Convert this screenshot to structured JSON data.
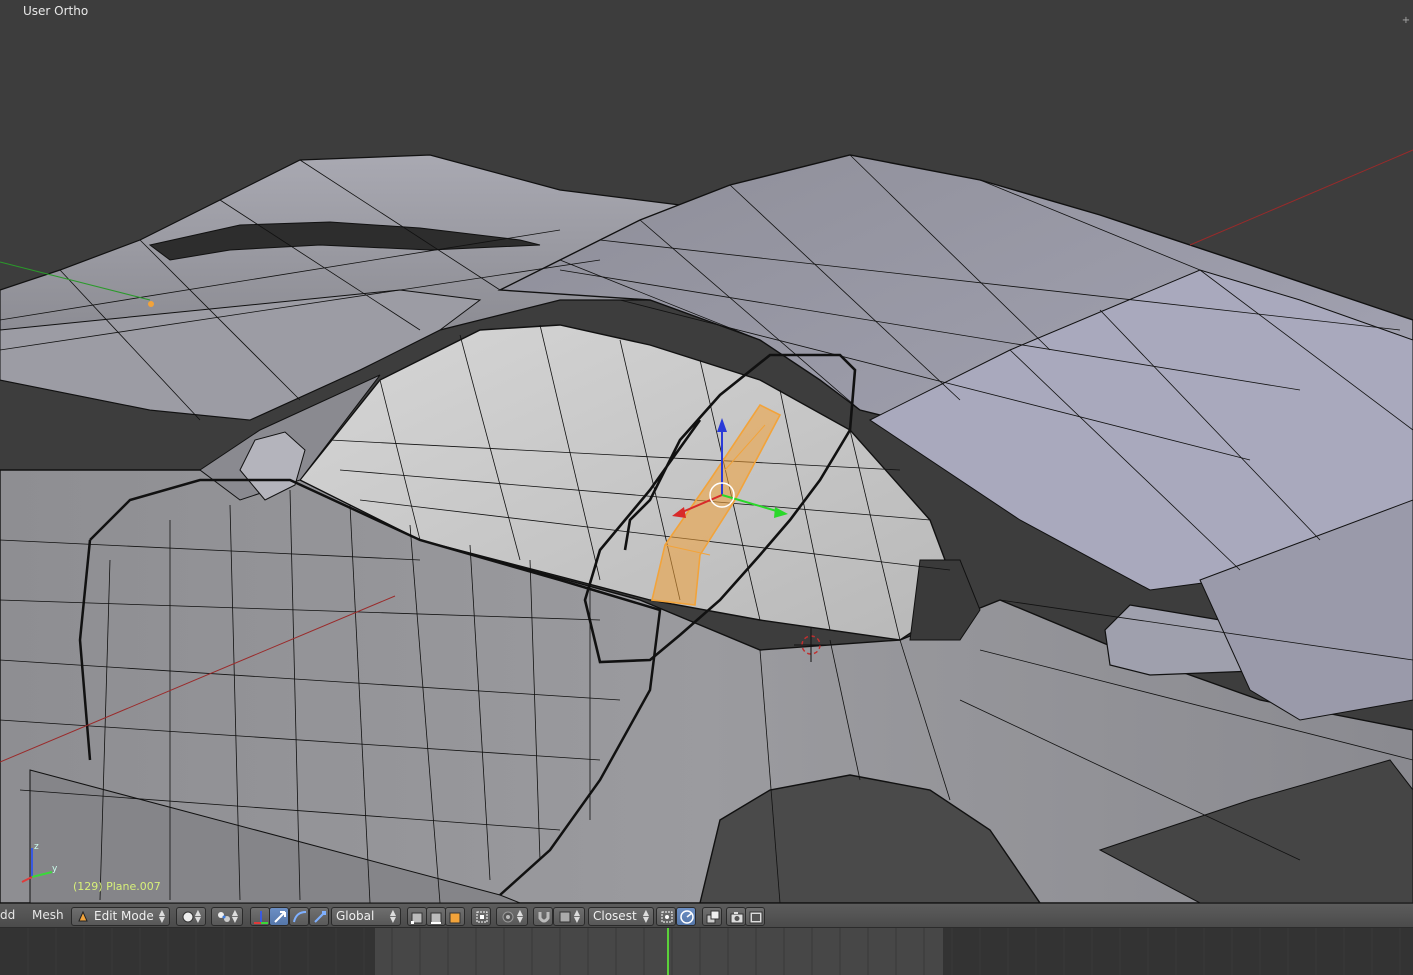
{
  "viewport": {
    "view_label": "User Ortho",
    "object_info": "(129) Plane.007",
    "corner_widget": "+",
    "axes": {
      "x": "x",
      "y": "y",
      "z": "z"
    }
  },
  "header": {
    "menus": [
      "dd",
      "Mesh"
    ],
    "mode": "Edit Mode",
    "pivot_icon": "pivot-icon",
    "transform_orientation": "Global",
    "snap_target": "Closest"
  },
  "colors": {
    "viewport_bg": "#3d3d3d",
    "selection": "#f2a33a",
    "info_text": "#d7f07a",
    "playhead": "#5bd13a"
  }
}
